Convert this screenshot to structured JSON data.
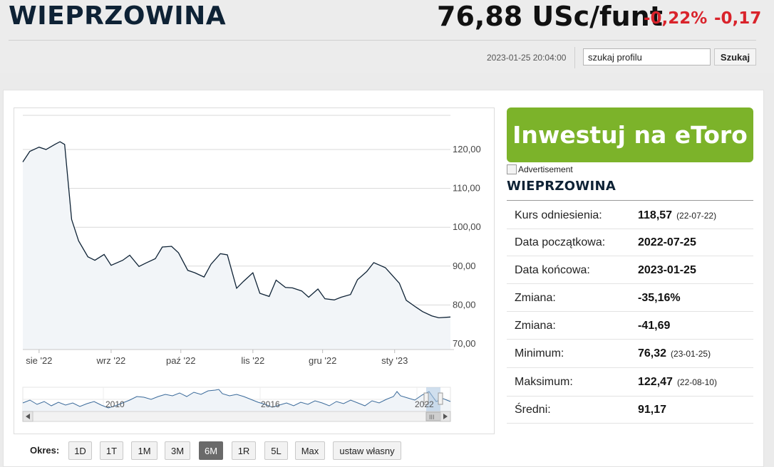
{
  "header": {
    "title": "WIEPRZOWINA",
    "price": "76,88 USc/funt",
    "change_pct": "-0,22%",
    "change_abs": "-0,17",
    "timestamp": "2023-01-25 20:04:00",
    "search_placeholder": "szukaj profilu",
    "search_button": "Szukaj"
  },
  "cta": {
    "label": "Inwestuj na eToro",
    "ad_alt": "Advertisement"
  },
  "stats": {
    "title": "WIEPRZOWINA",
    "rows": [
      {
        "label": "Kurs odniesienia:",
        "value": "118,57",
        "date": "(22-07-22)"
      },
      {
        "label": "Data początkowa:",
        "value": "2022-07-25",
        "date": ""
      },
      {
        "label": "Data końcowa:",
        "value": "2023-01-25",
        "date": ""
      },
      {
        "label": "Zmiana:",
        "value": "-35,16%",
        "date": ""
      },
      {
        "label": "Zmiana:",
        "value": "-41,69",
        "date": ""
      },
      {
        "label": "Minimum:",
        "value": "76,32",
        "date": "(23-01-25)"
      },
      {
        "label": "Maksimum:",
        "value": "122,47",
        "date": "(22-08-10)"
      },
      {
        "label": "Średni:",
        "value": "91,17",
        "date": ""
      }
    ]
  },
  "periods": {
    "label": "Okres:",
    "buttons": [
      "1D",
      "1T",
      "1M",
      "3M",
      "6M",
      "1R",
      "5L",
      "Max",
      "ustaw własny"
    ],
    "active": "6M"
  },
  "colors": {
    "accent": "#7cb32a",
    "negative": "#d9232b",
    "line": "#0e2235"
  },
  "chart_data": {
    "type": "line",
    "y_ticks": [
      "120,00",
      "110,00",
      "100,00",
      "90,00",
      "80,00",
      "70,00"
    ],
    "x_ticks": [
      "sie '22",
      "wrz '22",
      "paź '22",
      "lis '22",
      "gru '22",
      "sty '23"
    ],
    "ylim": [
      70,
      125
    ],
    "grid": true,
    "series": [
      {
        "x": [
          "2022-07-25",
          "2022-07-28",
          "2022-08-01",
          "2022-08-04",
          "2022-08-08",
          "2022-08-10",
          "2022-08-12",
          "2022-08-15",
          "2022-08-18",
          "2022-08-22",
          "2022-08-25",
          "2022-08-29",
          "2022-09-01",
          "2022-09-06",
          "2022-09-09",
          "2022-09-13",
          "2022-09-16",
          "2022-09-20",
          "2022-09-23",
          "2022-09-27",
          "2022-09-30",
          "2022-10-04",
          "2022-10-07",
          "2022-10-11",
          "2022-10-14",
          "2022-10-18",
          "2022-10-21",
          "2022-10-25",
          "2022-10-28",
          "2022-11-01",
          "2022-11-04",
          "2022-11-08",
          "2022-11-11",
          "2022-11-15",
          "2022-11-18",
          "2022-11-22",
          "2022-11-25",
          "2022-11-29",
          "2022-12-02",
          "2022-12-06",
          "2022-12-09",
          "2022-12-13",
          "2022-12-16",
          "2022-12-20",
          "2022-12-23",
          "2022-12-28",
          "2023-01-03",
          "2023-01-06",
          "2023-01-10",
          "2023-01-13",
          "2023-01-17",
          "2023-01-20",
          "2023-01-25"
        ],
        "y": [
          116.8,
          119.5,
          120.6,
          120.0,
          121.4,
          122.0,
          121.3,
          102.0,
          96.5,
          92.4,
          91.5,
          93.0,
          90.2,
          91.5,
          92.8,
          89.9,
          90.8,
          91.9,
          94.9,
          95.1,
          93.4,
          88.9,
          88.3,
          87.2,
          90.5,
          93.2,
          92.9,
          84.3,
          86.1,
          88.3,
          83.0,
          82.2,
          86.4,
          84.5,
          84.4,
          83.6,
          82.0,
          84.1,
          81.6,
          81.3,
          82.0,
          82.7,
          86.5,
          88.6,
          90.9,
          89.6,
          85.6,
          81.2,
          79.5,
          78.3,
          77.2,
          76.7,
          76.9
        ]
      }
    ]
  }
}
